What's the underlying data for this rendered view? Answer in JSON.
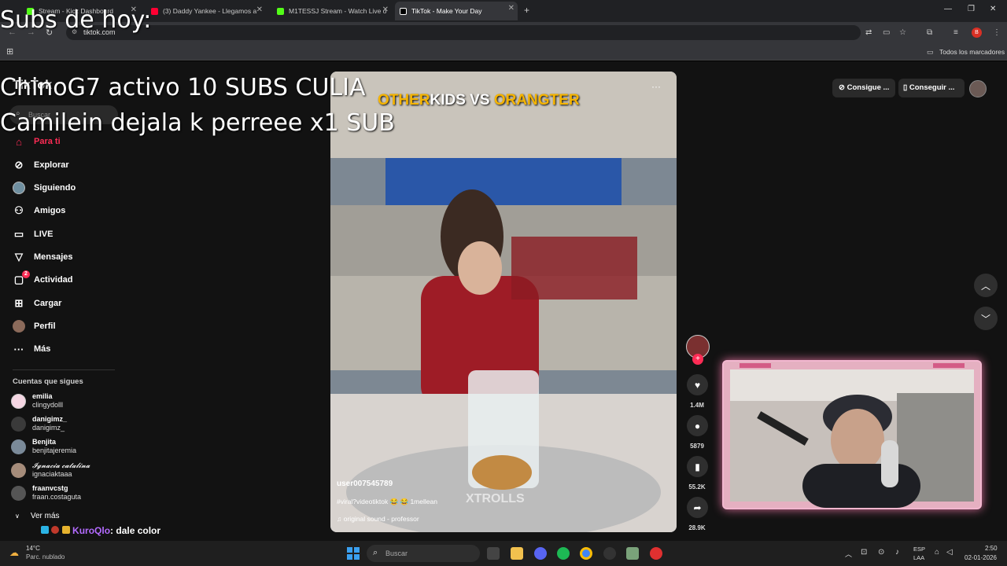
{
  "browser": {
    "tabs": [
      {
        "title": "Stream - Kick Dashboard",
        "color": "#53fc18"
      },
      {
        "title": "(3) Daddy Yankee - Llegamos a",
        "color": "#ff0033"
      },
      {
        "title": "M1TESSJ Stream - Watch Live o",
        "color": "#53fc18"
      },
      {
        "title": "TikTok - Make Your Day",
        "color": "#ffffff"
      }
    ],
    "url": "tiktok.com",
    "bookmarks_label": "Todos los marcadores"
  },
  "tiktok": {
    "logo": "TikTok",
    "search_placeholder": "Buscar",
    "nav": [
      {
        "label": "Para ti",
        "icon": "home-icon"
      },
      {
        "label": "Explorar",
        "icon": "compass-icon"
      },
      {
        "label": "Siguiendo",
        "icon": "following-avatar-icon"
      },
      {
        "label": "Amigos",
        "icon": "friends-icon"
      },
      {
        "label": "LIVE",
        "icon": "live-icon"
      },
      {
        "label": "Mensajes",
        "icon": "messages-icon"
      },
      {
        "label": "Actividad",
        "icon": "activity-icon",
        "badge": "2"
      },
      {
        "label": "Cargar",
        "icon": "upload-icon"
      },
      {
        "label": "Perfil",
        "icon": "profile-icon"
      },
      {
        "label": "Más",
        "icon": "more-icon"
      }
    ],
    "following_title": "Cuentas que sigues",
    "accounts": [
      {
        "name": "emilia",
        "handle": "clingydolll"
      },
      {
        "name": "danigimz_",
        "handle": "danigimz_"
      },
      {
        "name": "Benjita",
        "handle": "benjitajeremia"
      },
      {
        "name": "𝓘𝓰𝓷𝓪𝓬𝓲𝓪 𝓬𝓪𝓽𝓪𝓵𝓲𝓷𝓪",
        "handle": "ignaciaktaaa"
      },
      {
        "name": "fraanvcstg",
        "handle": "fraan.costaguta"
      }
    ],
    "see_more": "Ver más",
    "header_buttons": {
      "coins": "Consigue ...",
      "app": "Conseguir ..."
    },
    "video": {
      "title_part1": "OTHER",
      "title_part2": "KIDS VS",
      "title_part3": "ORANGTER",
      "author": "user007545789",
      "caption": "#viral?videotiktok 😂 😂 1mellean",
      "sound": "original sound - professor",
      "watermark": "XTROLLS"
    },
    "actions": {
      "likes": "1.4M",
      "comments": "5879",
      "saves": "55.2K",
      "shares": "28.9K"
    }
  },
  "overlay": {
    "subs_title": "Subs de hoy:",
    "line1": "ChinoG7 activo 10 SUBS CULIA",
    "line2": "Camilein dejala k perreee x1 SUB",
    "chat_user": "KuroQlo",
    "chat_msg": ": dale color"
  },
  "taskbar": {
    "weather_temp": "14°C",
    "weather_desc": "Parc. nublado",
    "search_placeholder": "Buscar",
    "lang_top": "ESP",
    "lang_bottom": "LAA",
    "time": "2:50",
    "date": "02-01-2026"
  }
}
